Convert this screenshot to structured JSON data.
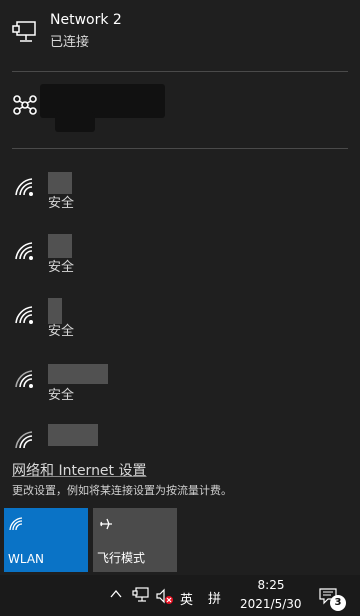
{
  "network_list": {
    "connected": {
      "name": "Network 2",
      "status": "已连接"
    },
    "wifi_networks": [
      {
        "security": "安全"
      },
      {
        "security": "安全"
      },
      {
        "security": "安全"
      },
      {
        "security": "安全"
      }
    ]
  },
  "settings": {
    "link": "网络和 Internet 设置",
    "description": "更改设置，例如将某连接设置为按流量计费。"
  },
  "quick_actions": [
    {
      "label": "WLAN",
      "icon": "wifi-icon",
      "state": "on"
    },
    {
      "label": "飞行模式",
      "icon": "airplane-icon",
      "state": "off"
    }
  ],
  "taskbar": {
    "ime_language": "英",
    "ime_mode": "拼",
    "time": "8:25",
    "date": "2021/5/30",
    "notification_count": "3"
  },
  "colors": {
    "panel_bg": "#1f1f1f",
    "accent": "#0a73c6",
    "mute_badge": "#e81123"
  }
}
